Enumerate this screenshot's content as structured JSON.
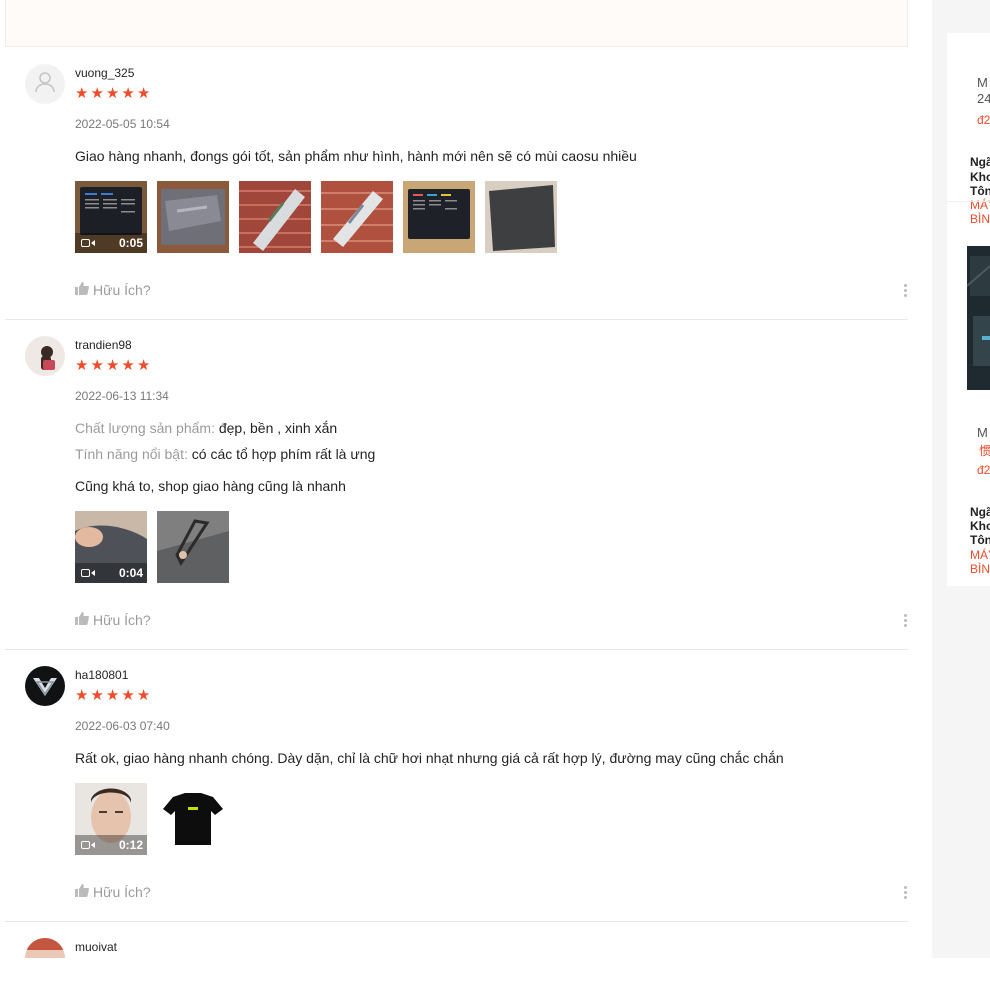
{
  "reviews": [
    {
      "username": "vuong_325",
      "rating": 5,
      "date": "2022-05-05 10:54",
      "text": "Giao hàng nhanh, đongs gói tốt, sản phẩm như hình, hành mới nên sẽ có mùi caosu nhiều",
      "video_duration": "0:05",
      "helpful_label": "Hữu Ích?"
    },
    {
      "username": "trandien98",
      "rating": 5,
      "date": "2022-06-13 11:34",
      "attributes": [
        {
          "label": "Chất lượng sản phẩm:",
          "value": "đẹp, bền , xinh xắn"
        },
        {
          "label": "Tính năng nổi bật:",
          "value": "có các tổ hợp phím rất là ưng"
        }
      ],
      "text": "Cũng khá to, shop giao hàng cũng là nhanh",
      "video_duration": "0:04",
      "helpful_label": "Hữu Ích?"
    },
    {
      "username": "ha180801",
      "rating": 5,
      "date": "2022-06-03 07:40",
      "text": "Rất ok, giao hàng nhanh chóng. Dày dặn, chỉ là chữ hơi nhạt nhưng giá cả rất hợp lý, đường may cũng chắc chắn",
      "video_duration": "0:12",
      "helpful_label": "Hữu Ích?"
    },
    {
      "username": "muoivat"
    }
  ],
  "sidebar": {
    "card1": {
      "l1": "M",
      "l2": "24",
      "price": "đ2"
    },
    "block1": {
      "b1": "Ngã",
      "b2": "Kho",
      "b3": "Tôn",
      "r1": "MÁY",
      "r2": "BÌN"
    },
    "card2": {
      "l1": "M",
      "tag": "惯",
      "price": "đ2"
    },
    "block2": {
      "b1": "Ngã",
      "b2": "Kho",
      "b3": "Tôn",
      "r1": "MÁY",
      "r2": "BÌN"
    }
  },
  "colors": {
    "accent": "#ee4d2d",
    "star": "#ee4d2d"
  },
  "icons": [
    "user-icon",
    "star-icon",
    "video-camera-icon",
    "thumb-up-icon",
    "more-vertical-icon"
  ]
}
